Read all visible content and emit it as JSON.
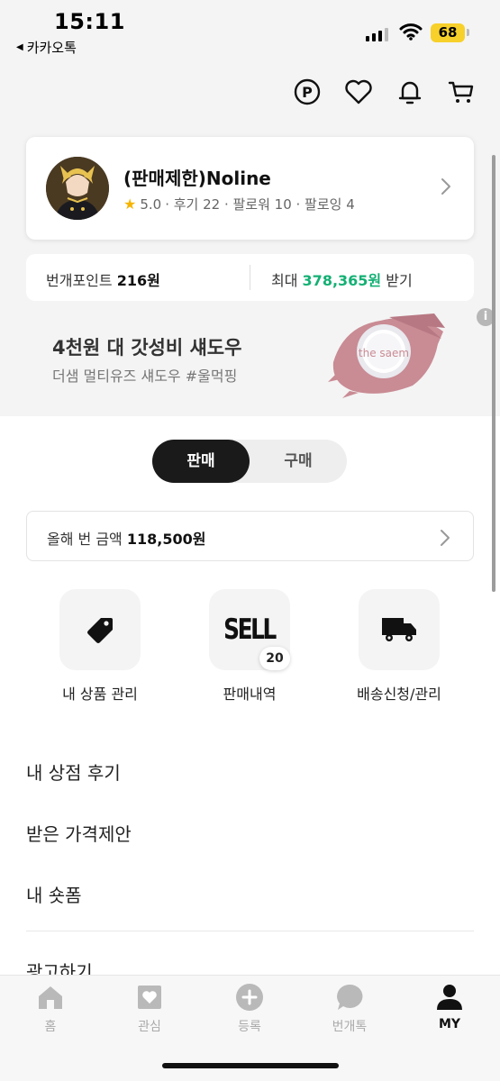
{
  "status_bar": {
    "time": "15:11",
    "back_app": "카카오톡",
    "battery": "68",
    "battery_color": "#f7d02a"
  },
  "header": {
    "icons": [
      "point-icon",
      "heart-icon",
      "bell-icon",
      "cart-icon"
    ]
  },
  "profile": {
    "name": "(판매제한)Noline",
    "rating": "5.0",
    "stats": "· 후기 22 · 팔로워 10 · 팔로잉 4"
  },
  "points": {
    "label": "번개포인트",
    "value": "216원",
    "max_label": "최대",
    "max_value": "378,365원",
    "max_suffix": "받기",
    "accent": "#14b074"
  },
  "ad": {
    "title": "4천원 대 갓성비 섀도우",
    "subtitle": "더샘 멀티유즈 섀도우 #울먹핑",
    "info": "i",
    "product_text": "the saem"
  },
  "tabs": {
    "sell": "판매",
    "buy": "구매"
  },
  "annual": {
    "label": "올해 번 금액",
    "value": "118,500원"
  },
  "quick_menu": {
    "items": [
      {
        "label": "내 상품 관리",
        "icon": "tag-icon"
      },
      {
        "label": "판매내역",
        "icon": "sell-icon",
        "icon_text": "SELL",
        "badge": "20"
      },
      {
        "label": "배송신청/관리",
        "icon": "truck-icon"
      }
    ]
  },
  "menu": {
    "items": [
      "내 상점 후기",
      "받은 가격제안",
      "내 숏폼",
      "광고하기"
    ]
  },
  "bottom_nav": {
    "items": [
      {
        "label": "홈",
        "icon": "home-icon"
      },
      {
        "label": "관심",
        "icon": "heart-box-icon"
      },
      {
        "label": "등록",
        "icon": "plus-icon"
      },
      {
        "label": "번개톡",
        "icon": "chat-icon"
      },
      {
        "label": "MY",
        "icon": "user-icon",
        "active": true
      }
    ]
  }
}
